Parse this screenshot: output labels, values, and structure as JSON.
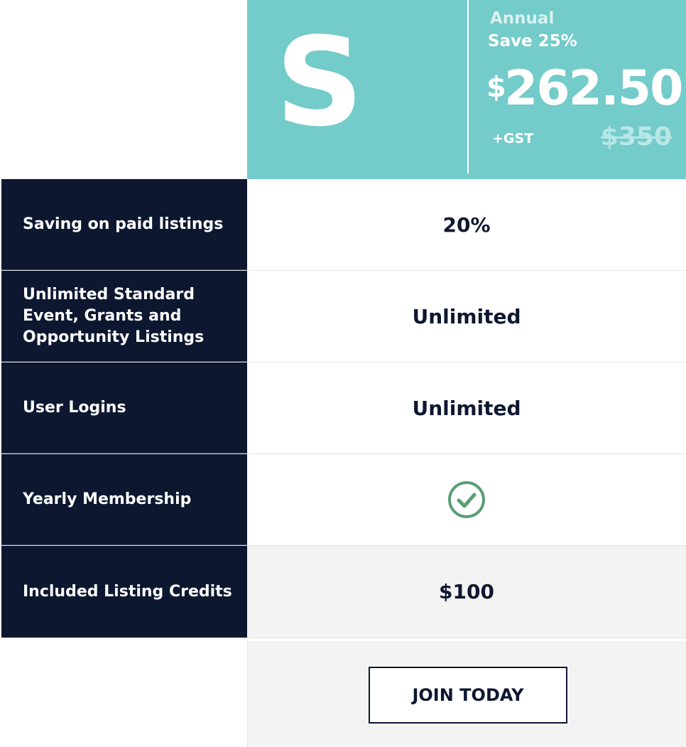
{
  "plan": {
    "letter": "S",
    "period": "Annual",
    "save": "Save 25%",
    "currency": "$",
    "price": "262.50",
    "tax": "+GST",
    "old_price": "$350"
  },
  "features": [
    {
      "label": "Saving on paid listings",
      "value": "20%"
    },
    {
      "label": "Unlimited Standard Event, Grants and Opportunity Listings",
      "value": "Unlimited"
    },
    {
      "label": "User Logins",
      "value": "Unlimited"
    },
    {
      "label": "Yearly Membership",
      "icon": "check-circle-icon"
    },
    {
      "label": "Included Listing Credits",
      "value": "$100"
    }
  ],
  "cta": {
    "label": "JOIN TODAY"
  },
  "colors": {
    "accent": "#73cbca",
    "navy": "#0e1730",
    "check": "#5a9f77"
  }
}
